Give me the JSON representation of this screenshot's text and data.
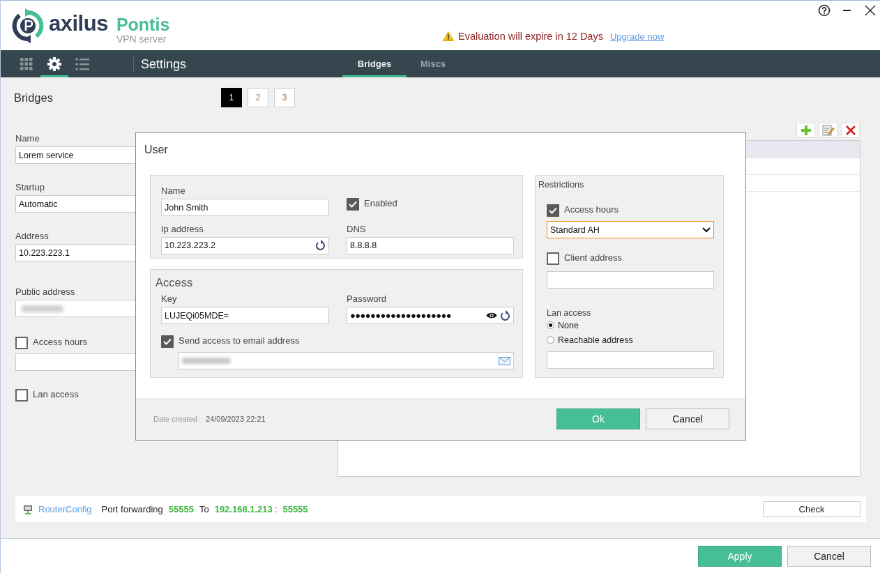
{
  "app": {
    "brand": "axilus",
    "product": "Pontis",
    "subtitle": "VPN server"
  },
  "window_controls": [
    {
      "kind": "help"
    },
    {
      "kind": "minimize"
    },
    {
      "kind": "close"
    }
  ],
  "notice": {
    "message": "Evaluation will expire in 12 Days",
    "link": "Upgrade now"
  },
  "nav": {
    "icons": [
      {
        "kind": "grid",
        "selected": false
      },
      {
        "kind": "gear",
        "selected": true
      },
      {
        "kind": "list",
        "selected": false
      }
    ],
    "title": "Settings",
    "tabs": [
      {
        "label": "Bridges",
        "selected": true
      },
      {
        "label": "Miscs",
        "selected": false
      }
    ]
  },
  "page": {
    "title": "Bridges",
    "pages": [
      {
        "label": "1",
        "selected": true
      },
      {
        "label": "2",
        "selected": false
      },
      {
        "label": "3",
        "selected": false
      }
    ]
  },
  "bridge_form": {
    "fields": [
      {
        "kind": "text",
        "label": "Name",
        "value": "Lorem service"
      },
      {
        "kind": "text",
        "label": "Startup",
        "value": "Automatic"
      },
      {
        "kind": "text",
        "label": "Address",
        "value": "10.223.223.1"
      },
      {
        "kind": "blurred",
        "label": "Public address"
      },
      {
        "kind": "checkbox_input",
        "label": "Access hours",
        "checked": false
      },
      {
        "kind": "checkbox",
        "label": "Lan access",
        "checked": false
      }
    ]
  },
  "list_toolbar": [
    {
      "kind": "add"
    },
    {
      "kind": "edit"
    },
    {
      "kind": "delete"
    }
  ],
  "router": {
    "link": "RouterConfig",
    "label": "Port forwarding",
    "port": "55555",
    "to": "To",
    "ip": "192.168.1.213",
    "separator": ":",
    "target_port": "55555",
    "button": "Check"
  },
  "dialog": {
    "title": "User",
    "name_label": "Name",
    "name": "John Smith",
    "enabled": {
      "label": "Enabled",
      "checked": true
    },
    "ip_label": "Ip address",
    "ip": "10.223.223.2",
    "dns_label": "DNS",
    "dns": "8.8.8.8",
    "access": {
      "title": "Access",
      "key_label": "Key",
      "key": "LUJEQi05MDE=",
      "password_label": "Password",
      "password": "●●●●●●●●●●●●●●●●●●●●",
      "send": {
        "label": "Send access to email address",
        "checked": true
      }
    },
    "restrictions": {
      "title": "Restrictions",
      "access_hours": {
        "label": "Access hours",
        "checked": true,
        "value": "Standard AH"
      },
      "client_address": {
        "label": "Client address",
        "checked": false
      },
      "lan_access": {
        "label": "Lan access",
        "options": [
          {
            "label": "None",
            "selected": true
          },
          {
            "label": "Reachable address",
            "selected": false
          }
        ]
      }
    },
    "date_label": "Date created",
    "date": "24/09/2023 22:21",
    "buttons": [
      {
        "label": "Ok",
        "kind": "primary"
      },
      {
        "label": "Cancel",
        "kind": "secondary"
      }
    ]
  },
  "footer_buttons": [
    {
      "label": "Apply",
      "kind": "primary"
    },
    {
      "label": "Cancel",
      "kind": "secondary"
    }
  ]
}
